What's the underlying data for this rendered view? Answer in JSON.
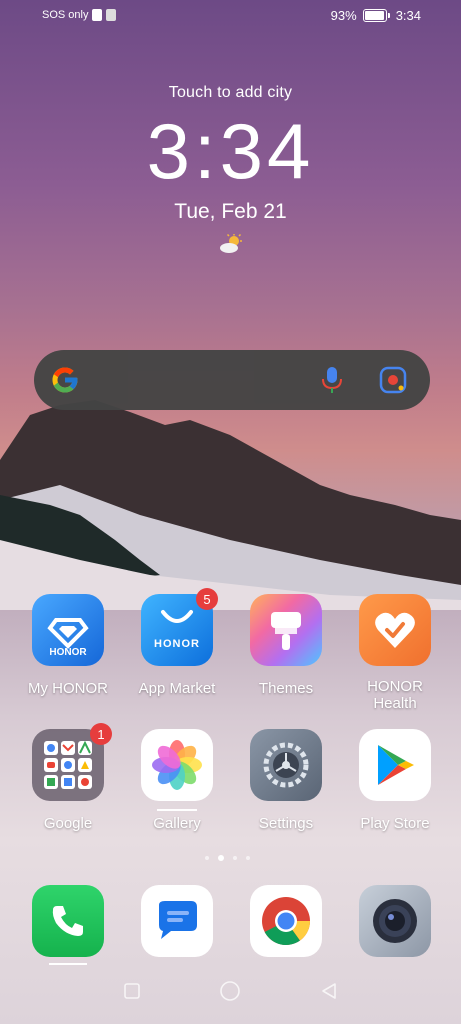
{
  "status_bar": {
    "carrier_text": "SOS only",
    "battery_percent": "93%",
    "time": "3:34"
  },
  "lockscreen": {
    "city_prompt": "Touch to add city",
    "clock": "3:34",
    "date": "Tue, Feb 21",
    "weather_icon": "partly-sunny-icon"
  },
  "search_bar": {
    "logo": "google-logo",
    "mic_icon": "mic-icon",
    "lens_icon": "google-lens-icon"
  },
  "apps_row1": [
    {
      "label": "My HONOR",
      "icon": "my-honor-icon",
      "icon_text": "HONOR",
      "color": "#1f7fe8"
    },
    {
      "label": "App Market",
      "icon": "app-market-icon",
      "icon_text": "HONOR",
      "badge": "5",
      "color": "#1b8ef0"
    },
    {
      "label": "Themes",
      "icon": "themes-brush-icon",
      "color": "#d74bb8"
    },
    {
      "label": "HONOR\nHealth",
      "icon": "honor-health-icon",
      "color": "#f17d3f"
    }
  ],
  "apps_row2": [
    {
      "label": "Google",
      "icon": "google-folder-icon",
      "badge": "1"
    },
    {
      "label": "Gallery",
      "icon": "gallery-flower-icon"
    },
    {
      "label": "Settings",
      "icon": "settings-gear-icon"
    },
    {
      "label": "Play Store",
      "icon": "play-store-icon"
    }
  ],
  "dock": [
    {
      "name": "Phone",
      "icon": "phone-icon",
      "color": "#1cc15b"
    },
    {
      "name": "Messages",
      "icon": "messages-icon",
      "color": "#1a73e8"
    },
    {
      "name": "Chrome",
      "icon": "chrome-icon"
    },
    {
      "name": "Camera",
      "icon": "camera-icon"
    }
  ],
  "page_indicator": {
    "pages": 4,
    "active": 1
  },
  "nav_bar": {
    "square": "recent-apps-icon",
    "circle": "home-icon",
    "triangle": "back-icon"
  }
}
